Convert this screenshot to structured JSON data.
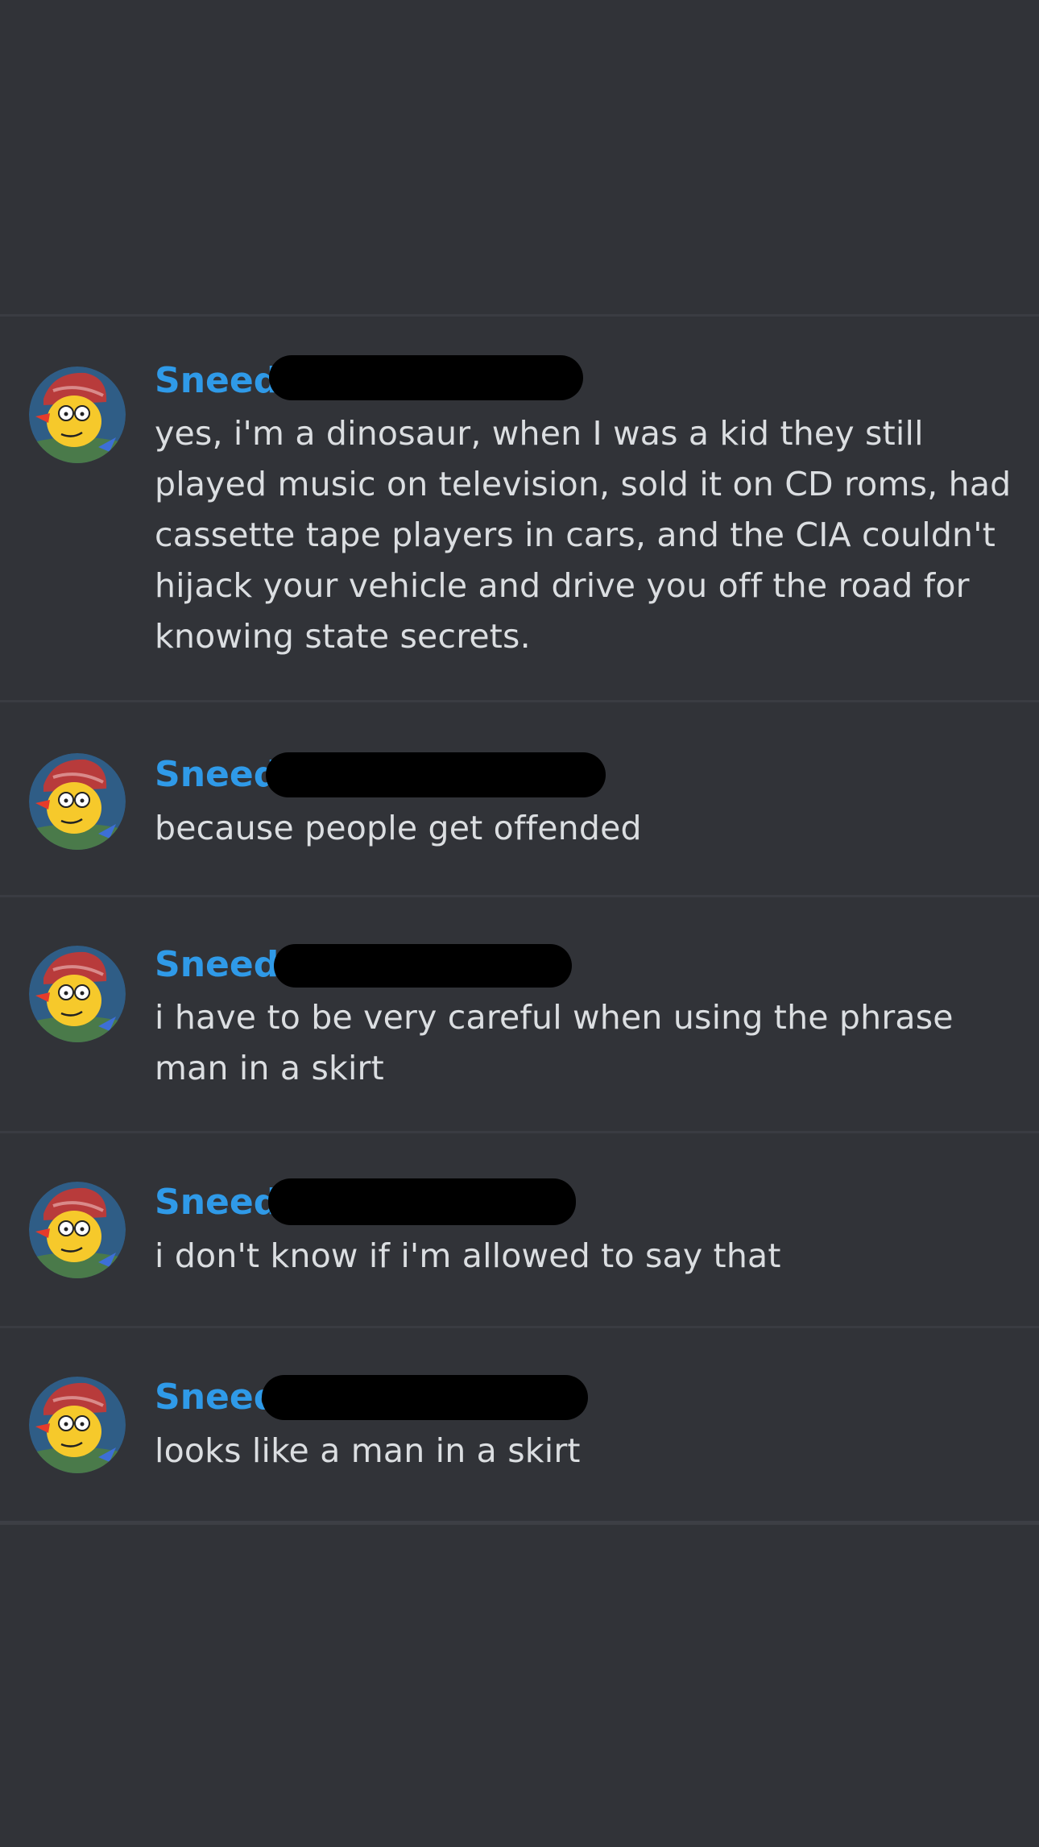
{
  "messages": [
    {
      "author": "Sneed",
      "text": "yes, i'm a dinosaur, when I was a kid they still played music on television, sold it on CD roms, had cassette tape players in cars, and the CIA couldn't hijack your vehicle and drive you off the road for knowing state secrets."
    },
    {
      "author": "Sneed",
      "text": "because people get offended"
    },
    {
      "author": "Sneed",
      "text": "i have to be very careful when using the phrase man in a skirt"
    },
    {
      "author": "Sneed",
      "text": "i don't know if i'm allowed to say that"
    },
    {
      "author": "Sneed",
      "text": "looks like a man in a skirt"
    }
  ],
  "colors": {
    "background": "#313338",
    "author_name": "#2f9ae8",
    "message_text": "#dbdee1",
    "divider": "#3a3c42",
    "redaction": "#000000"
  },
  "icons": {
    "avatar": "cartoon-man-red-cap-avatar"
  }
}
